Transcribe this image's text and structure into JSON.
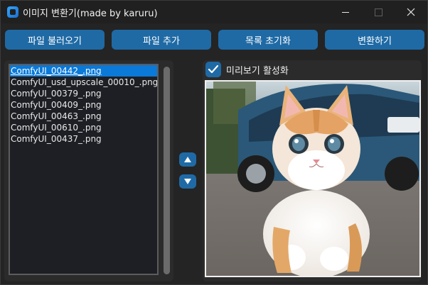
{
  "window": {
    "title": "이미지 변환기(made by karuru)",
    "controls": {
      "minimize": "—",
      "maximize": "☐",
      "close": "✕"
    }
  },
  "toolbar": {
    "load_files_label": "파일 불러오기",
    "add_file_label": "파일 추가",
    "reset_list_label": "목록 초기화",
    "convert_label": "변환하기"
  },
  "file_list": {
    "selected_index": 0,
    "items": [
      "ComfyUI_00442_.png",
      "ComfyUI_usd_upscale_00010_.png",
      "ComfyUI_00379_.png",
      "ComfyUI_00409_.png",
      "ComfyUI_00463_.png",
      "ComfyUI_00610_.png",
      "ComfyUI_00437_.png"
    ]
  },
  "reorder": {
    "up_icon": "triangle-up-icon",
    "down_icon": "triangle-down-icon"
  },
  "preview": {
    "checkbox_label": "미리보기 활성화",
    "checkbox_checked": true,
    "image_subject": "kitten sitting on road in front of blue car"
  },
  "colors": {
    "accent": "#1f6aa5",
    "selection": "#0a79d8",
    "background": "#242424",
    "panel": "#2b2b2b"
  }
}
